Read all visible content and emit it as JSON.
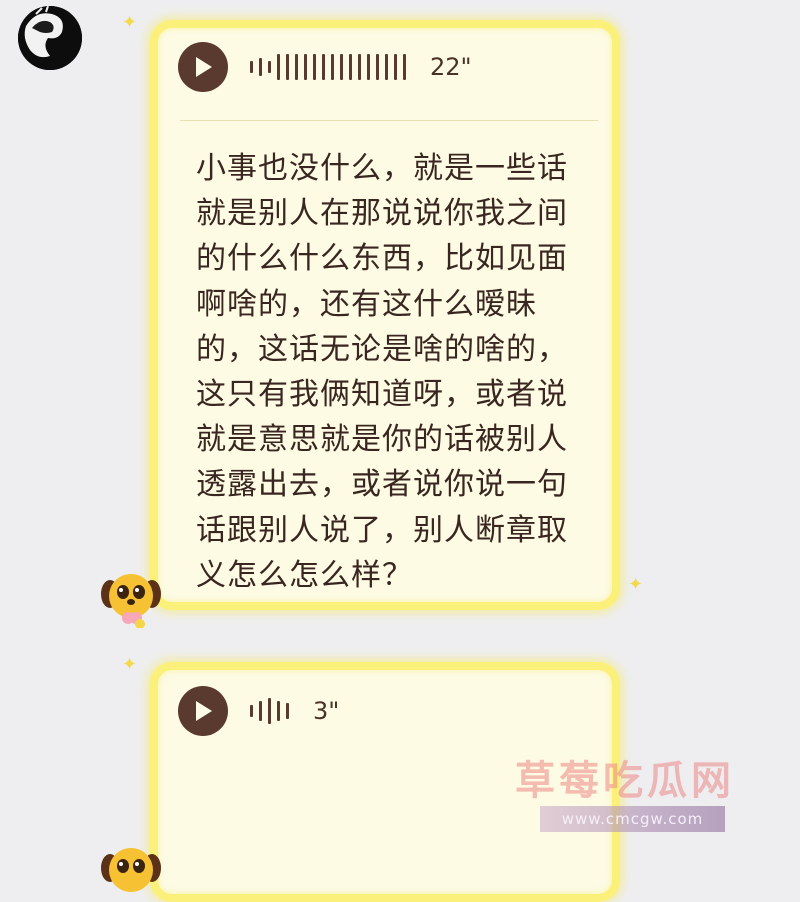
{
  "messages": [
    {
      "duration": "22\"",
      "transcript": "小事也没什么，就是一些话\n就是别人在那说说你我之间\n的什么什么东西，比如见面\n啊啥的，还有这什么暧昧\n的，这话无论是啥的啥的，\n这只有我俩知道呀，或者说\n就是意思就是你的话被别人\n透露出去，或者说你说一句\n话跟别人说了，别人断章取\n义怎么怎么样？"
    },
    {
      "duration": "3\""
    }
  ],
  "watermark": {
    "title": "草莓吃瓜网",
    "url": "www.cmcgw.com"
  },
  "colors": {
    "bubble_border": "#fbf07a",
    "bubble_fill": "#fdfbe3",
    "voice_icon": "#5a3a2f",
    "background": "#eeeef0"
  },
  "icons": {
    "play": "play-icon",
    "waveform": "voice-waveform-icon",
    "avatar_sender": "avatar",
    "avatar_receiver": "puppy-sticker-avatar"
  }
}
